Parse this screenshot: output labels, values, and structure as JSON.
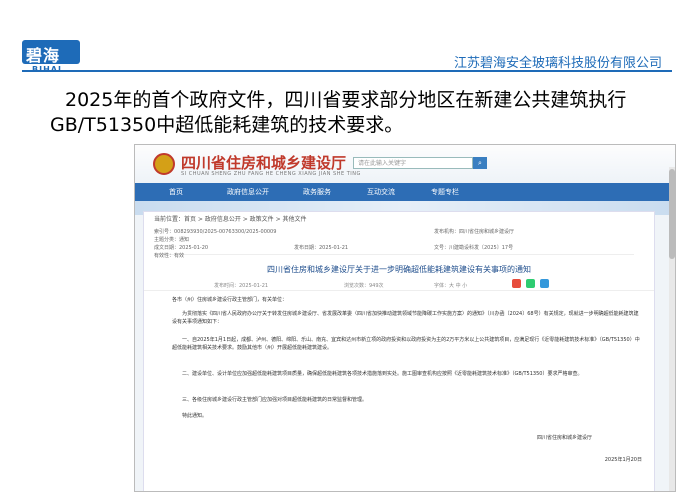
{
  "slide": {
    "logo_text": "碧海",
    "logo_sub": "BIHAI",
    "company": "江苏碧海安全玻璃科技股份有限公司",
    "caption": "2025年的首个政府文件，四川省要求部分地区在新建公共建筑执行GB/T51350中超低能耗建筑的技术要求。"
  },
  "site": {
    "title": "四川省住房和城乡建设厅",
    "pinyin": "SI CHUAN SHENG ZHU FANG HE CHENG XIANG JIAN SHE TING",
    "search_placeholder": "请在此输入关键字",
    "nav": [
      "首页",
      "政府信息公开",
      "政务服务",
      "互动交流",
      "专题专栏"
    ],
    "breadcrumb": "当前位置：首页 > 政府信息公开 > 政策文件 > 其他文件"
  },
  "doc": {
    "meta": [
      "索引号：008293930/2025-00763300/2025-00009",
      "主题分类：通知",
      "发布机构：四川省住房和城乡建设厅",
      "成文日期：2025-01-20",
      "发布日期：2025-01-21",
      "文号：川建勘设科发〔2025〕17号",
      "有效性：有效"
    ],
    "title": "四川省住房和城乡建设厅关于进一步明确超低能耗建筑建设有关事项的通知",
    "date_line": "发布时间：2025-01-21",
    "views": "浏览次数：949次",
    "font_size": "字体：大 中 小",
    "salutation": "各市（州）住房城乡建设行政主管部门，有关单位：",
    "paragraphs": [
      "为贯彻落实《四川省人民政府办公厅关于转发住房城乡建设厅、省发展改革委〈四川省加快推动建筑领域节能降碳工作实施方案〉的通知》（川办函〔2024〕68号）有关规定，现就进一步明确超低能耗建筑建设有关事项通知如下：",
      "一、自2025年1月1日起，成都、泸州、德阳、绵阳、乐山、南充、宜宾和达州市新立项的政府投资和以政府投资为主的2万平方米以上公共建筑项目，应满足现行《近零能耗建筑技术标准》（GB/T51350）中超低能耗建筑相关技术要求。鼓励其他市（州）开展超低能耗建筑建设。",
      "二、建设单位、设计单位应加强超低能耗建筑项目质量，确保超低能耗建筑各项技术措施落到实处。施工图审查机构应按照《近零能耗建筑技术标准》（GB/T51350）要求严格审查。",
      "三、各级住房城乡建设行政主管部门应加强对项目超低能耗建筑的日常监督和管理。",
      "特此通知。"
    ],
    "signature": "四川省住房和城乡建设厅",
    "sign_date": "2025年1月20日"
  },
  "colors": {
    "brand": "#1e6bb8",
    "site_red": "#c0392b",
    "nav_blue": "#2d6db5"
  }
}
